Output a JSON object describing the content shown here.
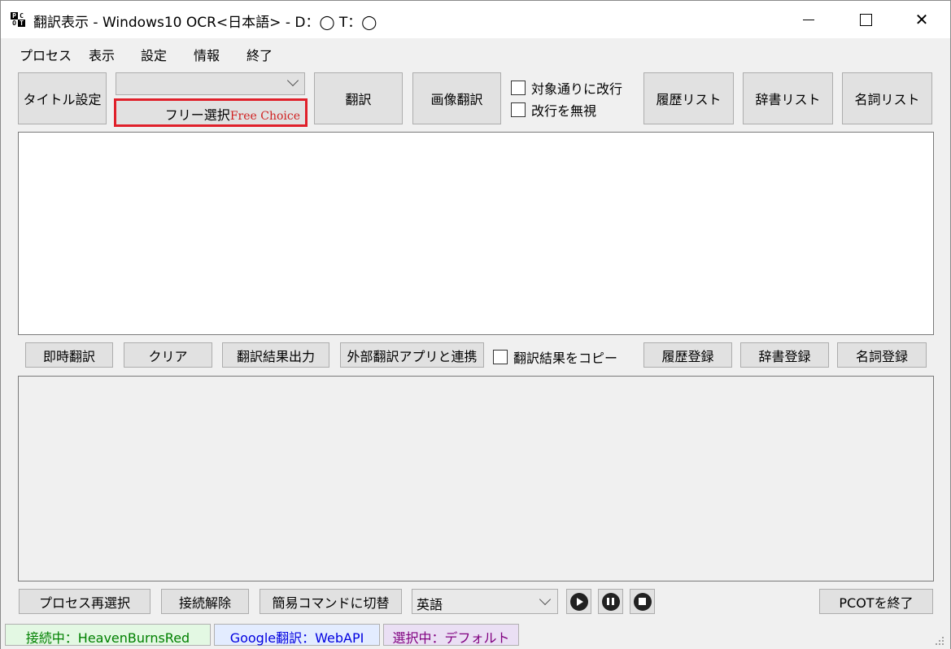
{
  "window": {
    "title": "翻訳表示 - Windows10 OCR<日本語> - D：◯ T：◯",
    "icon_letters": [
      "P",
      "C",
      "O",
      "T"
    ],
    "controls": {
      "minimize_icon": "minimize-icon",
      "maximize_icon": "maximize-icon",
      "close_glyph": "✕"
    }
  },
  "menu": {
    "items": [
      "プロセス",
      "表示",
      "設定",
      "情報",
      "終了"
    ]
  },
  "toolbar": {
    "title_setting": "タイトル設定",
    "combo_value": "",
    "free_choice_jp": "フリー選択",
    "free_choice_en": "Free Choice",
    "translate": "翻訳",
    "image_translate": "画像翻訳",
    "chk_linebreak_target": "対象通りに改行",
    "chk_ignore_linebreak": "改行を無視",
    "history_list": "履歴リスト",
    "dictionary_list": "辞書リスト",
    "noun_list": "名詞リスト"
  },
  "source_text": "",
  "actions": {
    "instant_translate": "即時翻訳",
    "clear": "クリア",
    "output_result": "翻訳結果出力",
    "external_app": "外部翻訳アプリと連携",
    "chk_copy_result": "翻訳結果をコピー",
    "register_history": "履歴登録",
    "register_dictionary": "辞書登録",
    "register_noun": "名詞登録"
  },
  "result_text": "",
  "bottom": {
    "reselect_process": "プロセス再選択",
    "disconnect": "接続解除",
    "switch_simple_command": "簡易コマンドに切替",
    "language": "英語",
    "play_icon": "play-icon",
    "pause_icon": "pause-icon",
    "stop_icon": "stop-icon",
    "exit_pcot": "PCOTを終了"
  },
  "status": {
    "connection": "接続中：HeavenBurnsRed",
    "translator": "Google翻訳：WebAPI",
    "selection": "選択中：デフォルト",
    "colors": {
      "connection": "#008000",
      "translator": "#0000e0",
      "selection": "#800080"
    }
  },
  "accent": {
    "free_choice_border": "#e0202a"
  }
}
